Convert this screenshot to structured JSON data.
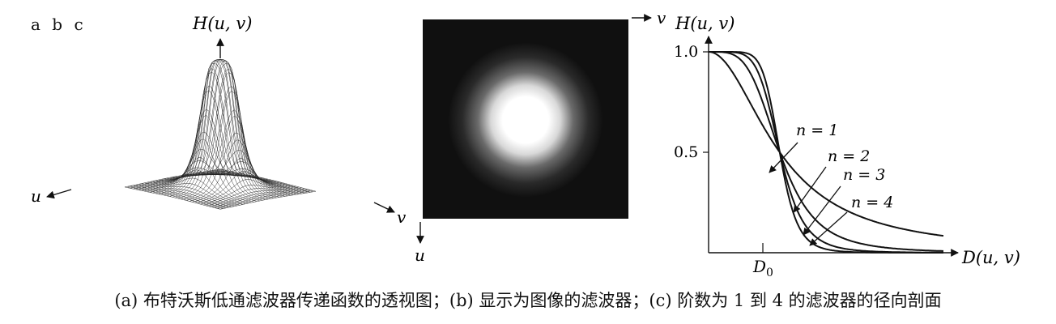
{
  "panel_labels": "a  b  c",
  "panel_a": {
    "z_axis_label": "H(u, v)",
    "u_axis_label": "u",
    "v_axis_label": "v"
  },
  "panel_b": {
    "v_axis_label": "v",
    "u_axis_label": "u"
  },
  "chart_data": {
    "type": "line",
    "ylabel": "H(u, v)",
    "xlabel": "D(u, v)",
    "x_tick_labels": [
      "D0"
    ],
    "x_tick_label_main": "D",
    "x_tick_label_sub": "0",
    "y_tick_labels": [
      "1.0",
      "0.5"
    ],
    "ylim": [
      0,
      1
    ],
    "xlim": [
      0,
      3.3
    ],
    "d0": 1,
    "series": [
      {
        "name": "n = 1",
        "order": 1
      },
      {
        "name": "n = 2",
        "order": 2
      },
      {
        "name": "n = 3",
        "order": 3
      },
      {
        "name": "n = 4",
        "order": 4
      }
    ]
  },
  "caption": "(a) 布特沃斯低通滤波器传递函数的透视图；(b) 显示为图像的滤波器；(c) 阶数为 1 到 4 的滤波器的径向剖面"
}
